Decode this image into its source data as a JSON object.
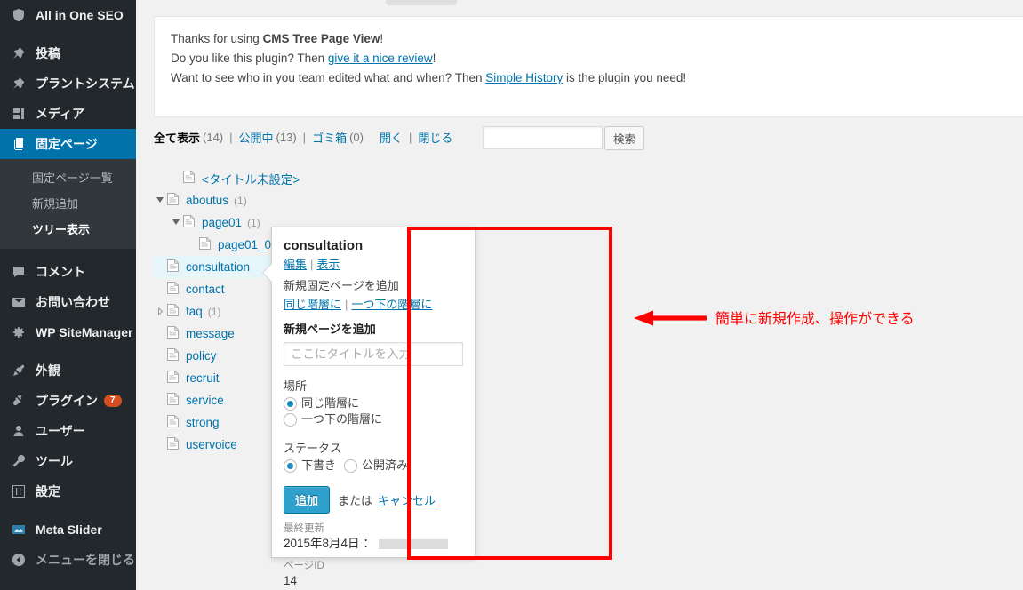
{
  "sidebar": {
    "items": [
      {
        "label": "All in One SEO",
        "icon": "shield-icon",
        "id": "all-in-one-seo"
      },
      {
        "label": "投稿",
        "icon": "pin-icon",
        "id": "posts"
      },
      {
        "label": "プラントシステム",
        "icon": "pin-icon",
        "id": "plant-system"
      },
      {
        "label": "メディア",
        "icon": "media-icon",
        "id": "media"
      },
      {
        "label": "固定ページ",
        "icon": "page-icon",
        "id": "pages",
        "current": true
      },
      {
        "label": "コメント",
        "icon": "comment-icon",
        "id": "comments"
      },
      {
        "label": "お問い合わせ",
        "icon": "mail-icon",
        "id": "contact-form"
      },
      {
        "label": "WP SiteManager",
        "icon": "gear-icon",
        "id": "wp-sitemanager"
      },
      {
        "label": "外観",
        "icon": "brush-icon",
        "id": "appearance"
      },
      {
        "label": "プラグイン",
        "icon": "plug-icon",
        "id": "plugins",
        "badge": "7"
      },
      {
        "label": "ユーザー",
        "icon": "user-icon",
        "id": "users"
      },
      {
        "label": "ツール",
        "icon": "wrench-icon",
        "id": "tools"
      },
      {
        "label": "設定",
        "icon": "sliders-icon",
        "id": "settings"
      },
      {
        "label": "Meta Slider",
        "icon": "slider-icon",
        "id": "meta-slider"
      }
    ],
    "submenu": [
      {
        "label": "固定ページ一覧",
        "current": false
      },
      {
        "label": "新規追加",
        "current": false
      },
      {
        "label": "ツリー表示",
        "current": true
      }
    ],
    "collapse_label": "メニューを閉じる",
    "collapse_icon": "chevron-left-circle-icon",
    "active_color": "#0073aa",
    "badge_color": "#d54e21"
  },
  "notice": {
    "line1_pre": "Thanks for using ",
    "line1_strong": "CMS Tree Page View",
    "line1_post": "!",
    "line2_pre": "Do you like this plugin? Then ",
    "line2_link": "give it a nice review",
    "line2_post": "!",
    "line3_pre": "Want to see who in you team edited what and when? Then ",
    "line3_link": "Simple History",
    "line3_post": " is the plugin you need!"
  },
  "filters": {
    "all_label": "全て表示",
    "all_count": "(14)",
    "published_label": "公開中",
    "published_count": "(13)",
    "trash_label": "ゴミ箱",
    "trash_count": "(0)",
    "expand_label": "開く",
    "collapse_label": "閉じる",
    "separator": "|",
    "search_value": "",
    "search_placeholder": "",
    "search_button": "検索"
  },
  "tree": {
    "rows": [
      {
        "label": "<タイトル未設定>",
        "count": "",
        "depth": 1,
        "twist": "none",
        "selected": false
      },
      {
        "label": "aboutus",
        "count": "(1)",
        "depth": 0,
        "twist": "open",
        "selected": false
      },
      {
        "label": "page01",
        "count": "(1)",
        "depth": 1,
        "twist": "open",
        "selected": false
      },
      {
        "label": "page01_0",
        "count": "",
        "depth": 2,
        "twist": "none",
        "selected": false
      },
      {
        "label": "consultation",
        "count": "",
        "depth": 0,
        "twist": "none",
        "selected": true
      },
      {
        "label": "contact",
        "count": "",
        "depth": 0,
        "twist": "none",
        "selected": false
      },
      {
        "label": "faq",
        "count": "(1)",
        "depth": 0,
        "twist": "closed",
        "selected": false
      },
      {
        "label": "message",
        "count": "",
        "depth": 0,
        "twist": "none",
        "selected": false
      },
      {
        "label": "policy",
        "count": "",
        "depth": 0,
        "twist": "none",
        "selected": false
      },
      {
        "label": "recruit",
        "count": "",
        "depth": 0,
        "twist": "none",
        "selected": false
      },
      {
        "label": "service",
        "count": "",
        "depth": 0,
        "twist": "none",
        "selected": false
      },
      {
        "label": "strong",
        "count": "",
        "depth": 0,
        "twist": "none",
        "selected": false
      },
      {
        "label": "uservoice",
        "count": "",
        "depth": 0,
        "twist": "none",
        "selected": false
      }
    ]
  },
  "popup": {
    "title": "consultation",
    "edit_link": "編集",
    "view_link": "表示",
    "add_page_label": "新規固定ページを追加",
    "add_same_level": "同じ階層に",
    "add_child_level": "一つ下の階層に",
    "new_page_heading": "新規ページを追加",
    "title_placeholder": "ここにタイトルを入力",
    "title_value": "",
    "place_label": "場所",
    "place_option_same": "同じ階層に",
    "place_option_child": "一つ下の階層に",
    "status_label": "ステータス",
    "status_option_draft": "下書き",
    "status_option_published": "公開済み",
    "add_button": "追加",
    "or_text": "または",
    "cancel_link": "キャンセル",
    "last_modified_label": "最終更新",
    "last_modified_value": "2015年8月4日 ：",
    "page_id_label": "ページID",
    "page_id_value": "14"
  },
  "annotation": {
    "text": "簡単に新規作成、操作ができる",
    "color": "#ff0000",
    "arrow_icon": "left-arrow-icon"
  }
}
